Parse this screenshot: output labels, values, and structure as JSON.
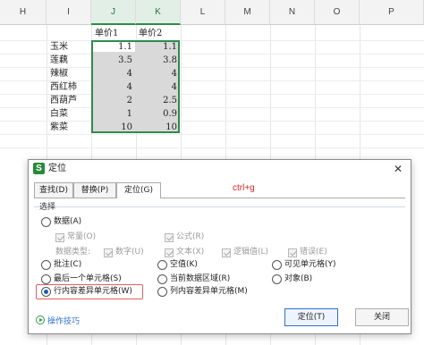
{
  "sheet": {
    "columns": [
      "H",
      "I",
      "J",
      "K",
      "L",
      "M",
      "N",
      "O",
      "P"
    ],
    "headers": [
      "单价1",
      "单价2"
    ],
    "rows": [
      {
        "name": "玉米",
        "v1": "1.1",
        "v2": "1.1"
      },
      {
        "name": "莲藕",
        "v1": "3.5",
        "v2": "3.8"
      },
      {
        "name": "辣椒",
        "v1": "4",
        "v2": "4"
      },
      {
        "name": "西红柿",
        "v1": "4",
        "v2": "4"
      },
      {
        "name": "西葫芦",
        "v1": "2",
        "v2": "2.5"
      },
      {
        "name": "白菜",
        "v1": "1",
        "v2": "0.9"
      },
      {
        "name": "紫菜",
        "v1": "10",
        "v2": "10"
      }
    ],
    "selection_color": "#2e8b4a"
  },
  "dialog": {
    "app_icon": "S",
    "title": "定位",
    "close": "✕",
    "tabs": [
      "查找(D)",
      "替换(P)",
      "定位(G)"
    ],
    "active_tab": 2,
    "hint": "ctrl+g",
    "section": "选择",
    "data_option": "数据(A)",
    "data_sub": {
      "constant": "常量(O)",
      "formula": "公式(R)"
    },
    "data_type_label": "数据类型:",
    "data_types": [
      "数字(U)",
      "文本(X)",
      "逻辑值(L)",
      "错误(E)"
    ],
    "options_col1": [
      "批注(C)",
      "最后一个单元格(S)",
      "行内容差异单元格(W)"
    ],
    "options_col2": [
      "空值(K)",
      "当前数据区域(R)",
      "列内容差异单元格(M)"
    ],
    "options_col3": [
      "可见单元格(Y)",
      "对象(B)"
    ],
    "selected_option": "行内容差异单元格(W)",
    "tips": "操作技巧",
    "ok": "定位(T)",
    "cancel": "关闭"
  }
}
